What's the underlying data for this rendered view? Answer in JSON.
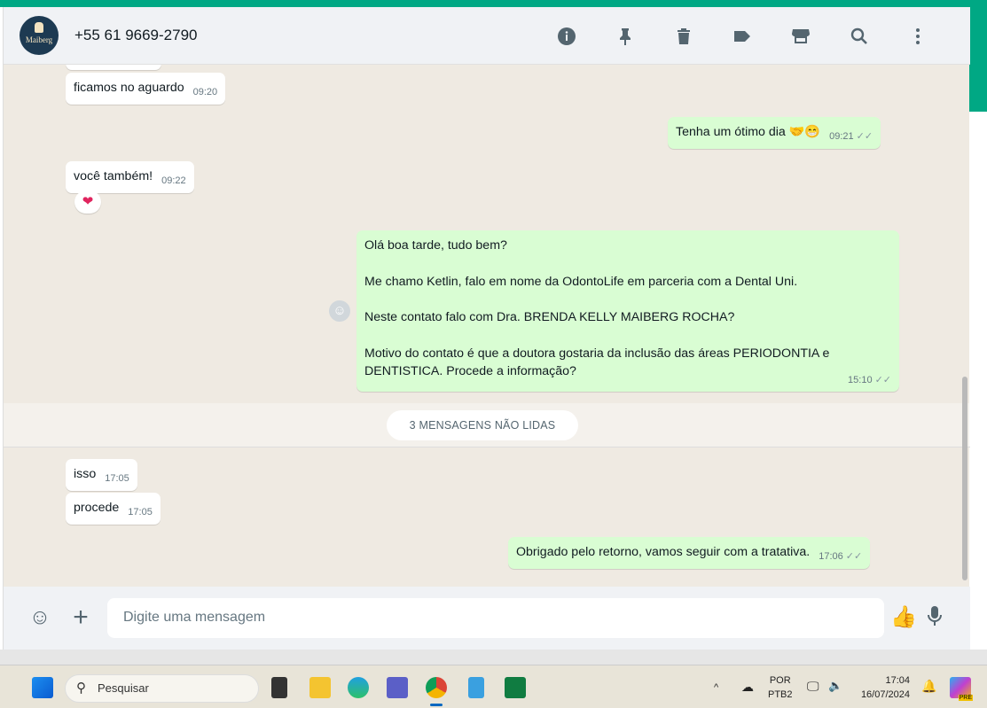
{
  "header": {
    "contact": "+55 61 9669-2790",
    "avatar_text": "Maiberg"
  },
  "messages": [
    {
      "dir": "in",
      "text": "ficamos no aguardo",
      "time": "09:20"
    },
    {
      "dir": "out",
      "text": "Tenha um ótimo dia 🤝😁",
      "time": "09:21"
    },
    {
      "dir": "in",
      "text": "você também!",
      "time": "09:22",
      "reaction": "❤"
    },
    {
      "dir": "out",
      "lines": [
        "Olá boa tarde, tudo bem?",
        "Me chamo Ketlin, falo em nome da OdontoLife em parceria com a Dental Uni.",
        "Neste contato falo com Dra. BRENDA KELLY MAIBERG ROCHA?",
        "Motivo do contato é que a doutora gostaria da inclusão das áreas PERIODONTIA e DENTISTICA. Procede a informação?"
      ],
      "time": "15:10"
    },
    {
      "dir": "in",
      "text": "isso",
      "time": "17:05"
    },
    {
      "dir": "in",
      "text": "procede",
      "time": "17:05"
    },
    {
      "dir": "out",
      "text": "Obrigado pelo retorno, vamos seguir com a tratativa.",
      "time": "17:06"
    }
  ],
  "unread_label": "3 MENSAGENS NÃO LIDAS",
  "composer": {
    "placeholder": "Digite uma mensagem"
  },
  "taskbar": {
    "search": "Pesquisar",
    "lang1": "POR",
    "lang2": "PTB2",
    "time": "17:04",
    "date": "16/07/2024",
    "copilot_badge": "PRE"
  }
}
